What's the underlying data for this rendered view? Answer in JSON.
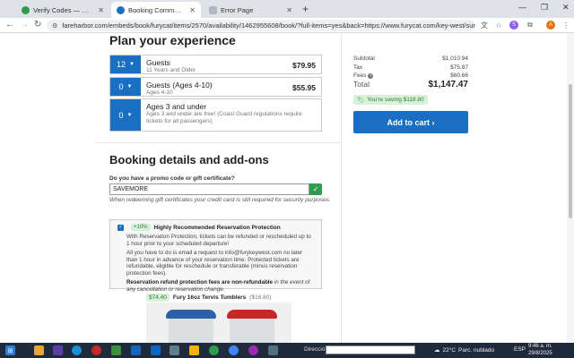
{
  "tabs": [
    {
      "label": "Verify Codes — SimplyCodes",
      "color": "#2e9c4e"
    },
    {
      "label": "Booking Commotion on the Oc",
      "color": "#1a6fc2"
    },
    {
      "label": "Error Page",
      "color": "#b0b8c4"
    }
  ],
  "address_bar": {
    "url": "fareharbor.com/embeds/book/furycat/items/2570/availability/1462955608/book/?full-items=yes&back=https://www.furycat.com/key-west/sunset-sailing-cruises&fl..."
  },
  "plan": {
    "title": "Plan your experience",
    "guests": [
      {
        "qty": "12",
        "name": "Guests",
        "sub": "11 Years and Older",
        "price": "$79.95"
      },
      {
        "qty": "0",
        "name": "Guests (Ages 4-10)",
        "sub": "Ages 4-10",
        "price": "$55.95"
      },
      {
        "qty": "0",
        "name": "Ages 3 and under",
        "sub": "Ages 3 and under are free! (Coast Guard regulations require tickets for all passengers)",
        "price": ""
      }
    ]
  },
  "booking": {
    "title": "Booking details and add-ons",
    "promo_label": "Do you have a promo code or gift certificate?",
    "promo_value": "SAVEMORE",
    "promo_note": "When redeeming gift certificates your credit card is still required for security purposes.",
    "protection": {
      "badge": "+10%",
      "title": "Highly Recommended Reservation Protection",
      "p1": "With Reservation Protection, tickets can be refunded or rescheduled up to 1 hour prior to your scheduled departure!",
      "p2": "All you have to do is email a request to info@furykeywest.com no later than 1 hour in advance of your reservation time. Protected tickets are refundable, eligible for reschedule or transferable (minus reservation protection fees).",
      "p3_bold": "Reservation refund protection fees are non-refundable",
      "p3_rest": " in the event of any cancellation or reservation change."
    },
    "product": {
      "price": "$74.40",
      "name": "Fury 16oz Tervis Tumblers",
      "orig": "($18.60)"
    }
  },
  "summary": {
    "subtotal_label": "Subtotal",
    "subtotal": "$1,010.94",
    "tax_label": "Tax",
    "tax": "$75.87",
    "fees_label": "Fees",
    "fees": "$60.66",
    "total_label": "Total",
    "total": "$1,147.47",
    "saving": "You're saving $118.80",
    "add_to_cart": "Add to cart ›"
  },
  "taskbar": {
    "address_label": "Dirección",
    "temp": "22°C",
    "weather": "Parc. nublado",
    "lang": "ESP",
    "time": "9:46 a. m.",
    "date": "29/8/2025"
  }
}
